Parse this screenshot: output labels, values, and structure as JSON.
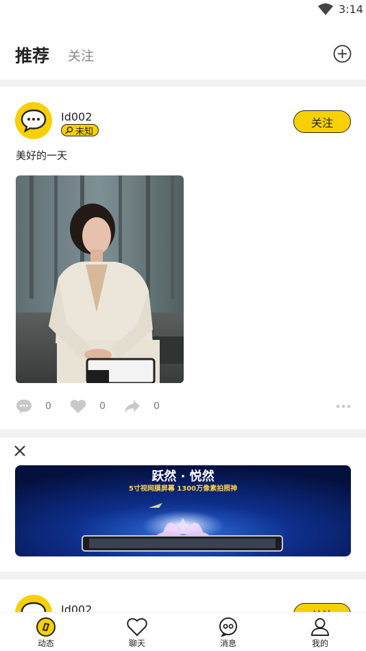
{
  "status_bar": {
    "time": "3:14"
  },
  "header": {
    "tabs": [
      {
        "label": "推荐",
        "active": true
      },
      {
        "label": "关注",
        "active": false
      }
    ]
  },
  "posts": [
    {
      "username": "Id002",
      "badge": "未知",
      "follow_label": "关注",
      "caption": "美好的一天",
      "actions": {
        "comments": "0",
        "likes": "0",
        "shares": "0"
      }
    },
    {
      "username": "Id002",
      "follow_label": "关注"
    }
  ],
  "ad": {
    "headline": "跃然 · 悦然",
    "subline": "5寸视网膜屏幕  1300万像素拍照神"
  },
  "bottom_nav": [
    {
      "label": "动态",
      "icon": "feed-icon",
      "active": true
    },
    {
      "label": "聊天",
      "icon": "heart-icon",
      "active": false
    },
    {
      "label": "消息",
      "icon": "message-icon",
      "active": false
    },
    {
      "label": "我的",
      "icon": "profile-icon",
      "active": false
    }
  ],
  "colors": {
    "accent": "#f7d000",
    "divider": "#f2f2f2",
    "muted_icon": "#c8c8c8"
  }
}
